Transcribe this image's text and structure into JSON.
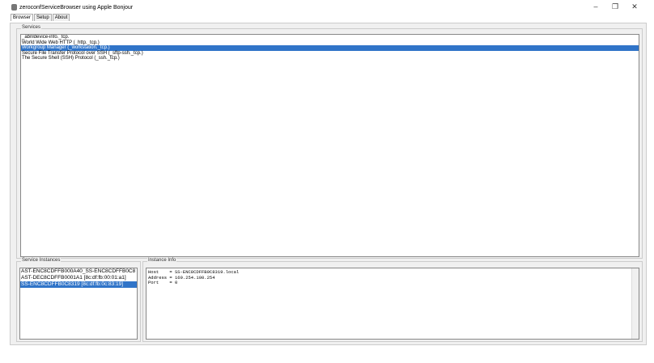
{
  "window": {
    "title": "zeroconfServiceBrowser using Apple Bonjour",
    "controls": [
      "–",
      "❐",
      "✕"
    ]
  },
  "tabs": [
    {
      "label": "Browser"
    },
    {
      "label": "Setup"
    },
    {
      "label": "About"
    }
  ],
  "services": {
    "label": "Services",
    "items": [
      "_abnldevice-info._tcp.",
      "World Wide Web HTTP (_http._tcp.)",
      "Workgroup Manager (_workstation._tcp.)",
      "Secure File Transfer Protocol over SSH (_sftp-ssh._tcp.)",
      "The Secure Shell (SSH) Protocol (_ssh._tcp.)"
    ],
    "selected_index": 2
  },
  "instances": {
    "label": "Service Instances",
    "items": [
      "AST-ENC8CDFFB000A40_SS-ENC8CDFFB0C8",
      "AST-DEC8CDFFB0001A1 [8c:df:fb:00:01:a1]",
      "SS-ENC8CDFFB0C8319 [8c:df:fb:0c:83:19]"
    ],
    "selected_index": 2
  },
  "info": {
    "label": "Instance Info",
    "lines": [
      "Host    = SS-ENC8CDFFB0C8319.local",
      "Address = 169.254.100.254",
      "Port    = 0"
    ]
  }
}
